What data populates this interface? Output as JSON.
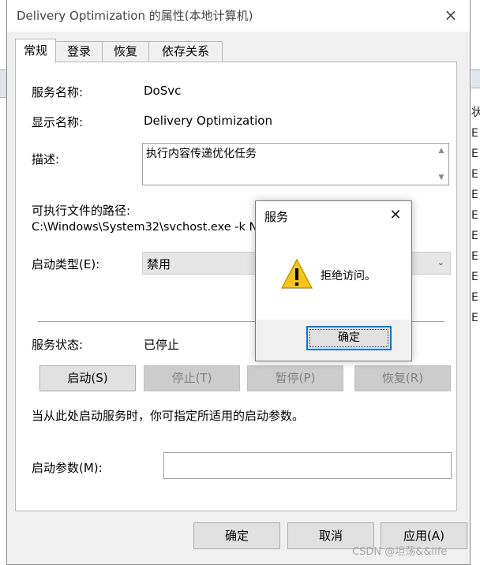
{
  "background": {
    "side_letters": [
      "状",
      "E",
      "E",
      "E",
      "E",
      "E",
      "E",
      "E",
      "E",
      "E",
      "E"
    ]
  },
  "dialog": {
    "title": "Delivery Optimization 的属性(本地计算机)",
    "close": "×",
    "tabs": [
      "常规",
      "登录",
      "恢复",
      "依存关系"
    ],
    "active_tab": "常规",
    "service_name_label": "服务名称:",
    "service_name_value": "DoSvc",
    "display_name_label": "显示名称:",
    "display_name_value": "Delivery Optimization",
    "description_label": "描述:",
    "description_value": "执行内容传递优化任务",
    "exe_path_label": "可执行文件的路径:",
    "exe_path_value": "C:\\Windows\\System32\\svchost.exe -k Ne",
    "startup_type_label": "启动类型(E):",
    "startup_type_value": "禁用",
    "service_status_label": "服务状态:",
    "service_status_value": "已停止",
    "buttons": {
      "start": "启动(S)",
      "stop": "停止(T)",
      "pause": "暂停(P)",
      "resume": "恢复(R)"
    },
    "hint": "当从此处启动服务时，你可指定所适用的启动参数。",
    "start_params_label": "启动参数(M):",
    "start_params_value": "",
    "footer": {
      "ok": "确定",
      "cancel": "取消",
      "apply": "应用(A)"
    }
  },
  "message_box": {
    "title": "服务",
    "close": "✕",
    "icon": "warning-icon",
    "message": "拒绝访问。",
    "ok": "确定"
  },
  "watermark": "CSDN @坦荡&&life",
  "colors": {
    "dialog_bg": "#f0f0f0",
    "focus_border": "#0078d7",
    "warning_yellow": "#f5c518"
  }
}
